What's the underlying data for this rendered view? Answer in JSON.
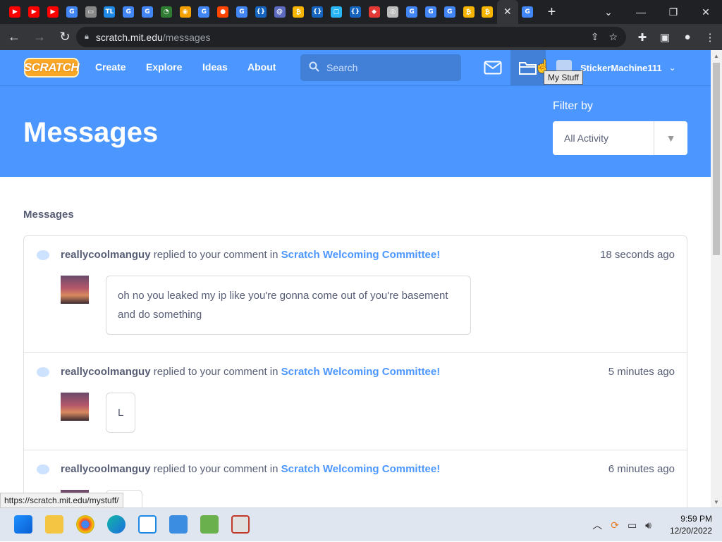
{
  "browser": {
    "tabs": [
      {
        "icon": "youtube-icon",
        "glyph": "▶",
        "color": "#ff0000"
      },
      {
        "icon": "youtube-icon",
        "glyph": "▶",
        "color": "#ff0000"
      },
      {
        "icon": "youtube-icon",
        "glyph": "▶",
        "color": "#ff0000"
      },
      {
        "icon": "google-icon",
        "glyph": "G",
        "color": "#4285f4"
      },
      {
        "icon": "monitor-icon",
        "glyph": "▭",
        "color": "#888888"
      },
      {
        "icon": "tl-icon",
        "glyph": "TL",
        "color": "#1e88e5"
      },
      {
        "icon": "google-icon",
        "glyph": "G",
        "color": "#4285f4"
      },
      {
        "icon": "google-icon",
        "glyph": "G",
        "color": "#4285f4"
      },
      {
        "icon": "wifi-icon",
        "glyph": "◔",
        "color": "#2e7d32"
      },
      {
        "icon": "app-icon",
        "glyph": "◉",
        "color": "#f4a000"
      },
      {
        "icon": "google-icon",
        "glyph": "G",
        "color": "#4285f4"
      },
      {
        "icon": "reddit-icon",
        "glyph": "●",
        "color": "#ff4500"
      },
      {
        "icon": "google-icon",
        "glyph": "G",
        "color": "#4285f4"
      },
      {
        "icon": "braces-icon",
        "glyph": "{}",
        "color": "#1565c0"
      },
      {
        "icon": "at-icon",
        "glyph": "@",
        "color": "#5c6bc0"
      },
      {
        "icon": "bitcoin-icon",
        "glyph": "₿",
        "color": "#f7b500"
      },
      {
        "icon": "braces-icon",
        "glyph": "{}",
        "color": "#1565c0"
      },
      {
        "icon": "chat-icon",
        "glyph": "▢",
        "color": "#29b6f6"
      },
      {
        "icon": "braces-icon",
        "glyph": "{}",
        "color": "#1565c0"
      },
      {
        "icon": "roblox-icon",
        "glyph": "◆",
        "color": "#e53935"
      },
      {
        "icon": "chrome-icon",
        "glyph": "◎",
        "color": "#bdbdbd"
      },
      {
        "icon": "google-icon",
        "glyph": "G",
        "color": "#4285f4"
      },
      {
        "icon": "google-icon",
        "glyph": "G",
        "color": "#4285f4"
      },
      {
        "icon": "google-icon",
        "glyph": "G",
        "color": "#4285f4"
      },
      {
        "icon": "bitcoin-icon",
        "glyph": "₿",
        "color": "#f7b500"
      },
      {
        "icon": "bitcoin-icon",
        "glyph": "₿",
        "color": "#f7b500"
      }
    ],
    "active_tab_close": "✕",
    "last_tab": {
      "icon": "google-icon",
      "glyph": "G",
      "color": "#4285f4"
    },
    "new_tab": "+",
    "url_host": "scratch.mit.edu",
    "url_path": "/messages",
    "status_url": "https://scratch.mit.edu/mystuff/"
  },
  "nav": {
    "logo": "SCRATCH",
    "links": [
      "Create",
      "Explore",
      "Ideas",
      "About"
    ],
    "search_placeholder": "Search",
    "username": "StickerMachine111",
    "tooltip": "My Stuff"
  },
  "header": {
    "title": "Messages",
    "filter_label": "Filter by",
    "filter_value": "All Activity"
  },
  "messages": {
    "section_title": "Messages",
    "items": [
      {
        "user": "reallycoolmanguy",
        "action": "replied to your comment in",
        "studio": "Scratch Welcoming Committee!",
        "time": "18 seconds ago",
        "comment": "oh no you leaked my ip like you're gonna come out of you're basement and do something"
      },
      {
        "user": "reallycoolmanguy",
        "action": "replied to your comment in",
        "studio": "Scratch Welcoming Committee!",
        "time": "5 minutes ago",
        "comment": "L"
      },
      {
        "user": "reallycoolmanguy",
        "action": "replied to your comment in",
        "studio": "Scratch Welcoming Committee!",
        "time": "6 minutes ago",
        "comment": ""
      }
    ]
  },
  "taskbar": {
    "time": "9:59 PM",
    "date": "12/20/2022"
  },
  "colors": {
    "scratch_blue": "#4c97ff",
    "link_blue": "#4c97ff",
    "text_gray": "#575e75"
  }
}
